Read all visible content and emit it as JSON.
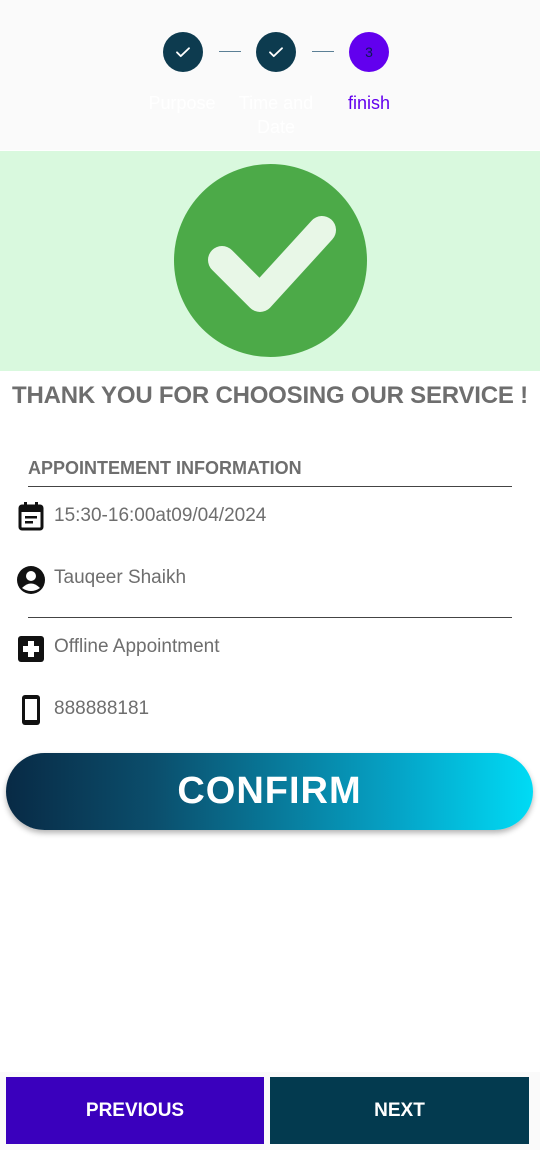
{
  "stepper": {
    "steps": [
      {
        "label": "Purpose",
        "status": "done"
      },
      {
        "label": "Time and\nDate",
        "status": "done"
      },
      {
        "label": "finish",
        "status": "active",
        "number": "3"
      }
    ]
  },
  "hero": {
    "icon": "check-mark-icon"
  },
  "thank_you": "THANK YOU FOR CHOOSING OUR SERVICE !",
  "info": {
    "title": "APPOINTEMENT INFORMATION",
    "datetime": "15:30-16:00at09/04/2024",
    "name": "Tauqeer Shaikh",
    "type": "Offline Appointment",
    "phone": "888888181"
  },
  "confirm_label": "CONFIRM",
  "nav": {
    "previous_label": "PREVIOUS",
    "next_label": "NEXT"
  },
  "colors": {
    "step_done": "#0d3b4f",
    "step_active": "#6200ee",
    "success_green": "#4caa48",
    "hero_bg": "#d9f9de",
    "previous_bg": "#3a00bd",
    "next_bg": "#033a4f"
  }
}
